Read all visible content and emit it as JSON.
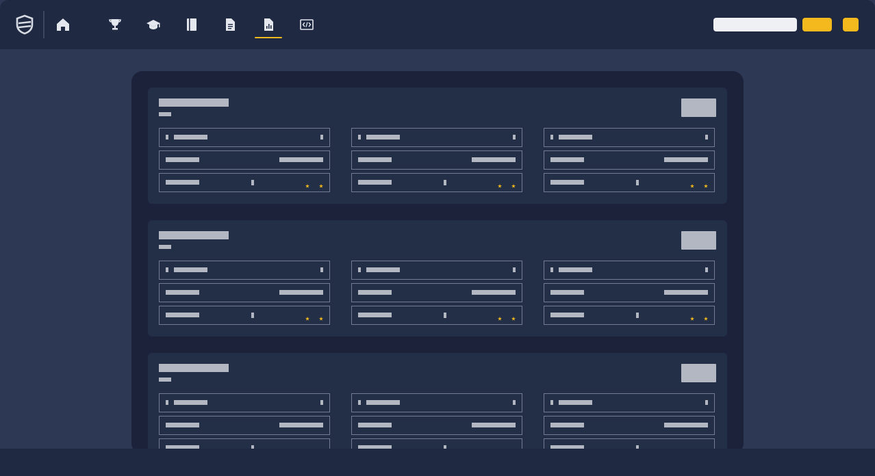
{
  "brand": {
    "accent": "#f4b91c",
    "topbar_bg": "#1f2942",
    "page_bg": "#2d3855",
    "panel_bg": "#1b2239",
    "card_bg": "#232e47"
  },
  "nav": {
    "logo_icon": "shield-logo-icon",
    "home_icon": "home-icon",
    "items": [
      {
        "name": "tab-trophy",
        "icon": "trophy-icon"
      },
      {
        "name": "tab-courses",
        "icon": "graduation-cap-icon"
      },
      {
        "name": "tab-notebook",
        "icon": "notebook-icon"
      },
      {
        "name": "tab-document",
        "icon": "document-icon"
      },
      {
        "name": "tab-report",
        "icon": "report-chart-icon",
        "active": true
      },
      {
        "name": "tab-code",
        "icon": "code-icon"
      }
    ]
  },
  "cards": [
    {
      "rows": 3,
      "columns": 3,
      "rating_stars": 2
    },
    {
      "rows": 3,
      "columns": 3,
      "rating_stars": 2
    },
    {
      "rows": 3,
      "columns": 3,
      "rating_stars": 2
    }
  ],
  "rating_icon": "star-icon"
}
